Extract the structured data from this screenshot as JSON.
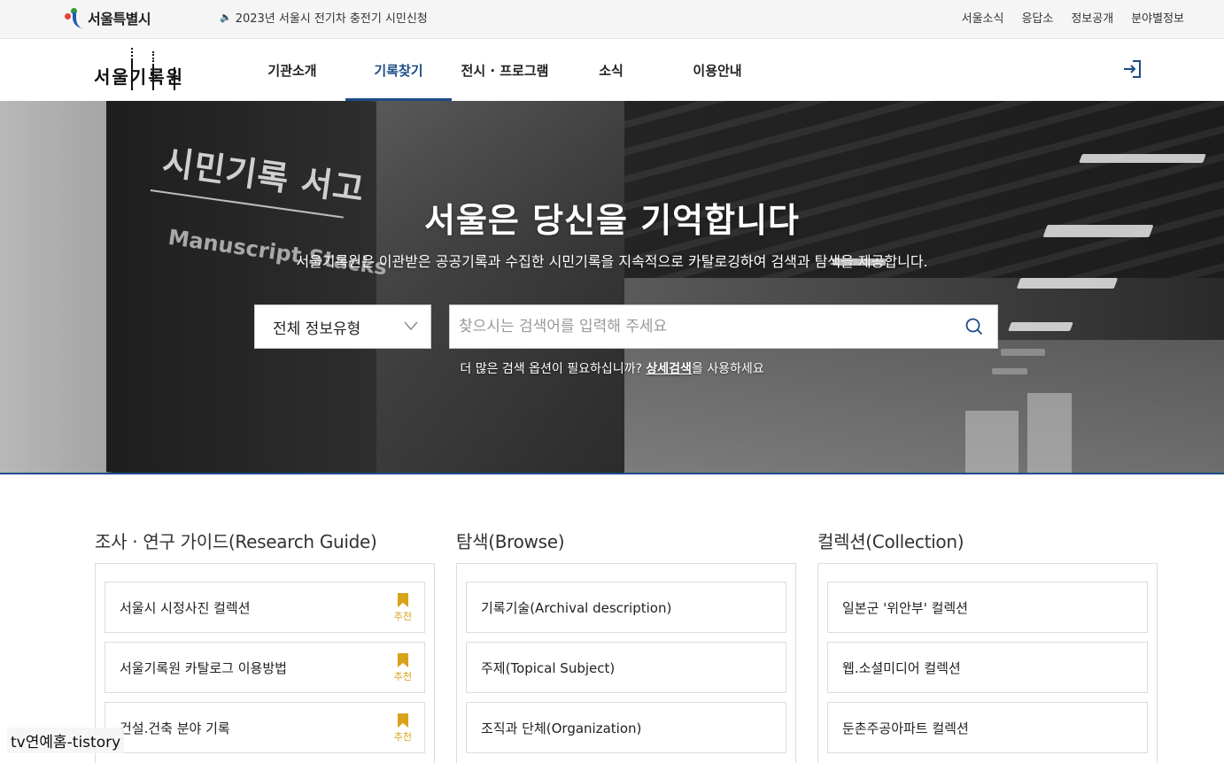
{
  "topbar": {
    "logo_text": "서울특별시",
    "notice": "2023년 서울시 전기차 충전기 시민신청",
    "links": [
      "서울소식",
      "응답소",
      "정보공개",
      "분야별정보"
    ]
  },
  "nav": {
    "brand": "서울기록원",
    "menu": [
      "기관소개",
      "기록찾기",
      "전시 · 프로그램",
      "소식",
      "이용안내"
    ],
    "active_index": 1
  },
  "hero": {
    "sign_title": "시민기록 서고",
    "sign_sub": "Manuscript Stacks",
    "title": "서울은 당신을 기억합니다",
    "subtitle": "서울기록원은 이관받은 공공기록과 수집한 시민기록을 지속적으로 카탈로깅하여 검색과 탐색을 제공합니다.",
    "select_value": "전체 정보유형",
    "search_placeholder": "찾으시는 검색어를 입력해 주세요",
    "more_prefix": "더 많은 검색 옵션이 필요하십니까? ",
    "more_link": "상세검색",
    "more_suffix": "을 사용하세요"
  },
  "sections": [
    {
      "title": "조사 · 연구 가이드(Research Guide)",
      "items": [
        {
          "label": "서울시 시정사진 컬렉션",
          "badge": "추천"
        },
        {
          "label": "서울기록원 카탈로그 이용방법",
          "badge": "추천"
        },
        {
          "label": "건설.건축 분야 기록",
          "badge": "추천"
        }
      ]
    },
    {
      "title": "탐색(Browse)",
      "items": [
        {
          "label": "기록기술(Archival description)"
        },
        {
          "label": "주제(Topical Subject)"
        },
        {
          "label": "조직과 단체(Organization)"
        }
      ]
    },
    {
      "title": "컬렉션(Collection)",
      "items": [
        {
          "label": "일본군 '위안부' 컬렉션"
        },
        {
          "label": "웹.소셜미디어 컬렉션"
        },
        {
          "label": "둔촌주공아파트 컬렉션"
        }
      ]
    }
  ],
  "watermark": "tv연예홈-tistory",
  "colors": {
    "accent": "#1d4c86",
    "badge": "#d9a21b"
  }
}
